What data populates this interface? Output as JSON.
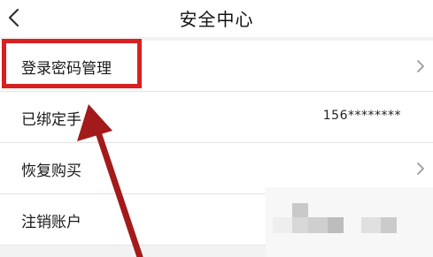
{
  "header": {
    "title": "安全中心",
    "back_icon": "chevron-left-icon"
  },
  "rows": [
    {
      "label": "登录密码管理",
      "value": "",
      "has_chevron": true
    },
    {
      "label": "已绑定手",
      "value": "156********",
      "has_chevron": false
    },
    {
      "label": "恢复购买",
      "value": "",
      "has_chevron": true
    },
    {
      "label": "注销账户",
      "value": "",
      "has_chevron": false
    }
  ],
  "annotation": {
    "highlight_color": "#d92020",
    "arrow_color": "#a31a1a"
  }
}
